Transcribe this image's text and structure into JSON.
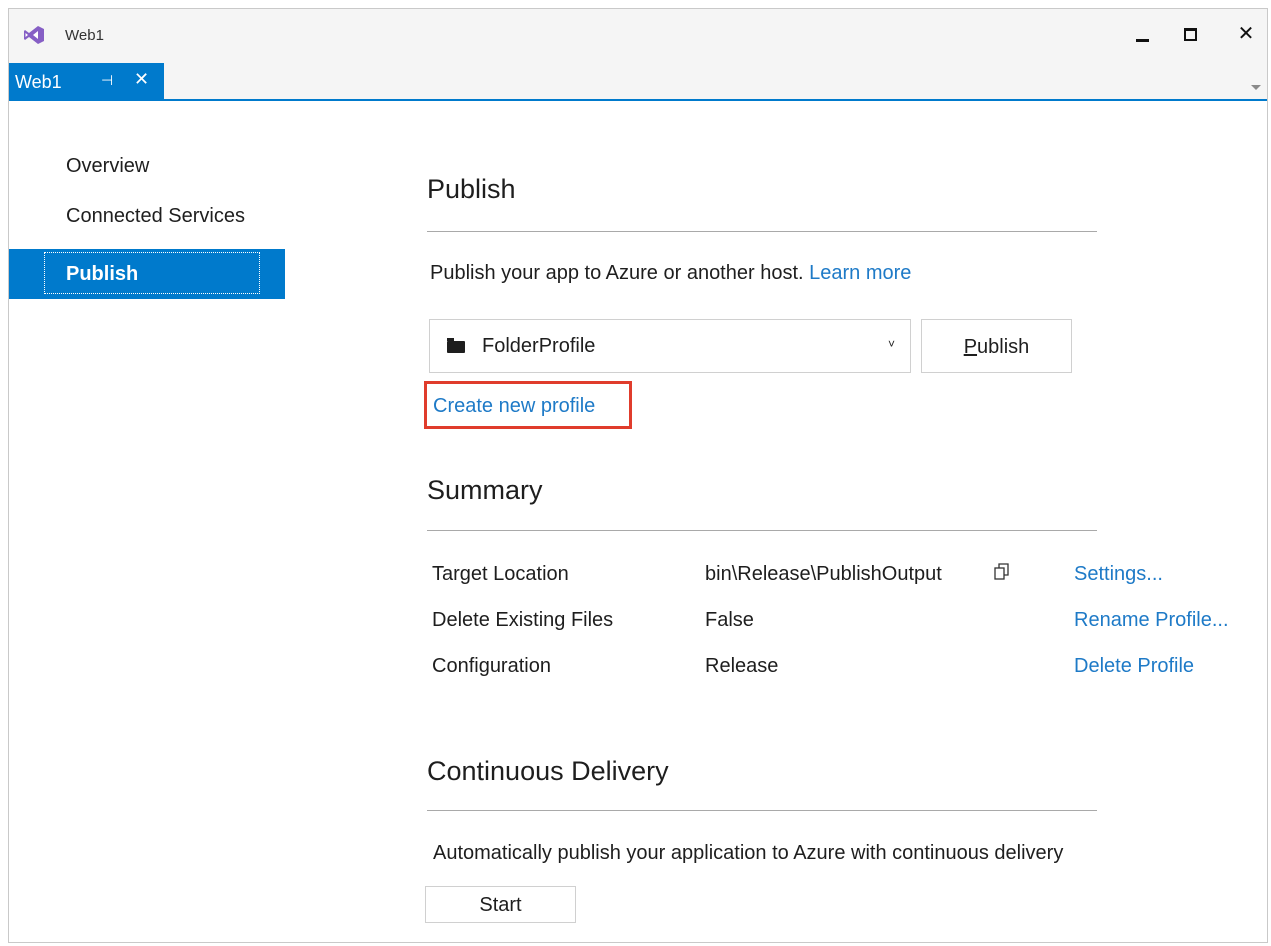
{
  "window": {
    "title": "Web1",
    "close_glyph": "✕",
    "minimize_icon": "minimize-icon",
    "maximize_icon": "maximize-icon",
    "app_icon": "visual-studio-logo-icon"
  },
  "tab": {
    "label": "Web1",
    "pin_glyph": "⊣",
    "close_glyph": "✕"
  },
  "nav": {
    "items": [
      {
        "label": "Overview",
        "selected": false
      },
      {
        "label": "Connected Services",
        "selected": false
      },
      {
        "label": "Publish",
        "selected": true
      }
    ]
  },
  "publish": {
    "title": "Publish",
    "description": "Publish your app to Azure or another host.",
    "learn_more": "Learn more",
    "profile": {
      "selected": "FolderProfile",
      "icon": "folder-icon"
    },
    "publish_button": {
      "prefix": "",
      "accesskey": "P",
      "suffix": "ublish"
    },
    "create_profile": "Create new profile"
  },
  "summary": {
    "title": "Summary",
    "rows": [
      {
        "label": "Target Location",
        "value": "bin\\Release\\PublishOutput",
        "action": "Settings..."
      },
      {
        "label": "Delete Existing Files",
        "value": "False",
        "action": "Rename Profile..."
      },
      {
        "label": "Configuration",
        "value": "Release",
        "action": "Delete Profile"
      }
    ]
  },
  "continuous_delivery": {
    "title": "Continuous Delivery",
    "description": "Automatically publish your application to Azure with continuous delivery",
    "start_button": "Start"
  },
  "colors": {
    "accent": "#007acc",
    "link": "#1e7ac7",
    "highlight_box": "#e03c2c"
  }
}
